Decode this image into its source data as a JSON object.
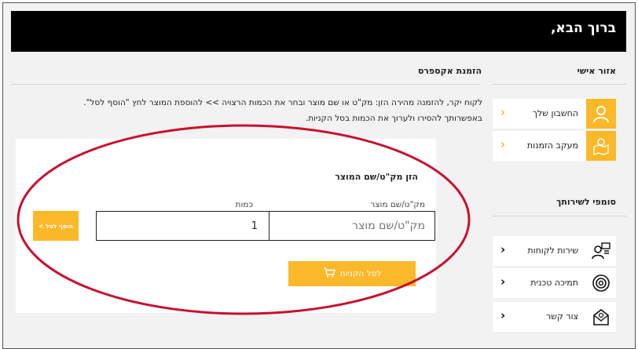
{
  "header": {
    "title": "ברוך הבא,"
  },
  "sidebar": {
    "personal_heading": "אזור אישי",
    "personal_items": [
      {
        "label": "החשבון שלך",
        "icon": "user-icon"
      },
      {
        "label": "מעקב הזמנות",
        "icon": "map-tracking-icon"
      }
    ],
    "service_heading": "סומפי לשירותך",
    "service_items": [
      {
        "label": "שירות לקוחות",
        "icon": "customer-service-icon"
      },
      {
        "label": "תמיכה טכנית",
        "icon": "settings-support-icon"
      },
      {
        "label": "צור קשר",
        "icon": "envelope-contact-icon"
      }
    ]
  },
  "main": {
    "heading": "הזמנת אקספרס",
    "intro_line1": "לקוח יקר, להזמנה מהירה הזן: מק\"ט או שם מוצר ובחר את הכמות הרצויה >> להוספת המוצר לחץ \"הוסף לסל\".",
    "intro_line2": "באפשרותך להסירו ולערוך את הכמות בסל הקניות.",
    "form": {
      "heading": "הזן מק\"ט/שם המוצר",
      "sku_label": "מק\"ט/שם מוצר",
      "sku_placeholder": "מק\"ט/שם מוצר",
      "qty_label": "כמות",
      "qty_value": "1",
      "add_button": "הוסף לסל >",
      "cart_button": "לסל הקניות"
    }
  },
  "colors": {
    "accent": "#fbb829",
    "header_bg": "#000000",
    "annotation": "#c8102e"
  }
}
